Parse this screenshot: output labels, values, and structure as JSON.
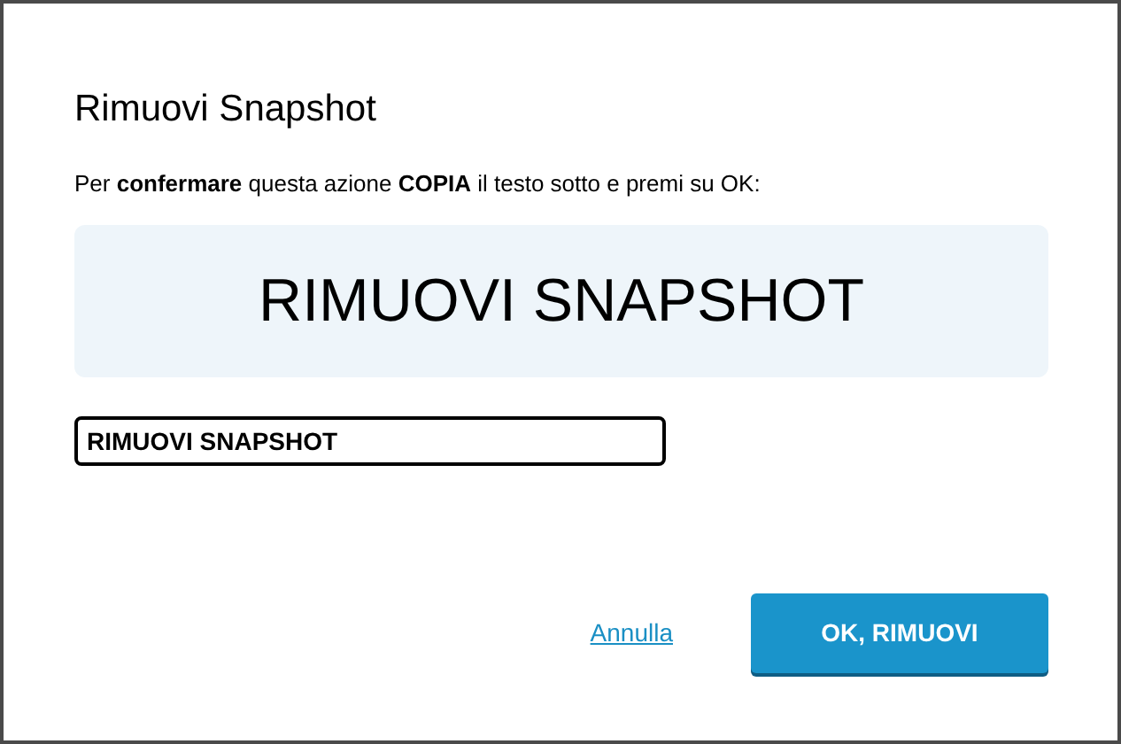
{
  "dialog": {
    "title": "Rimuovi Snapshot",
    "instruction": "Per **confermare** questa azione **COPIA** il testo sotto e premi su OK:",
    "confirm_text": "RIMUOVI SNAPSHOT",
    "input": {
      "value": "RIMUOVI SNAPSHOT"
    },
    "cancel_link": "Annulla",
    "confirm_button": "OK, RIMUOVI"
  }
}
